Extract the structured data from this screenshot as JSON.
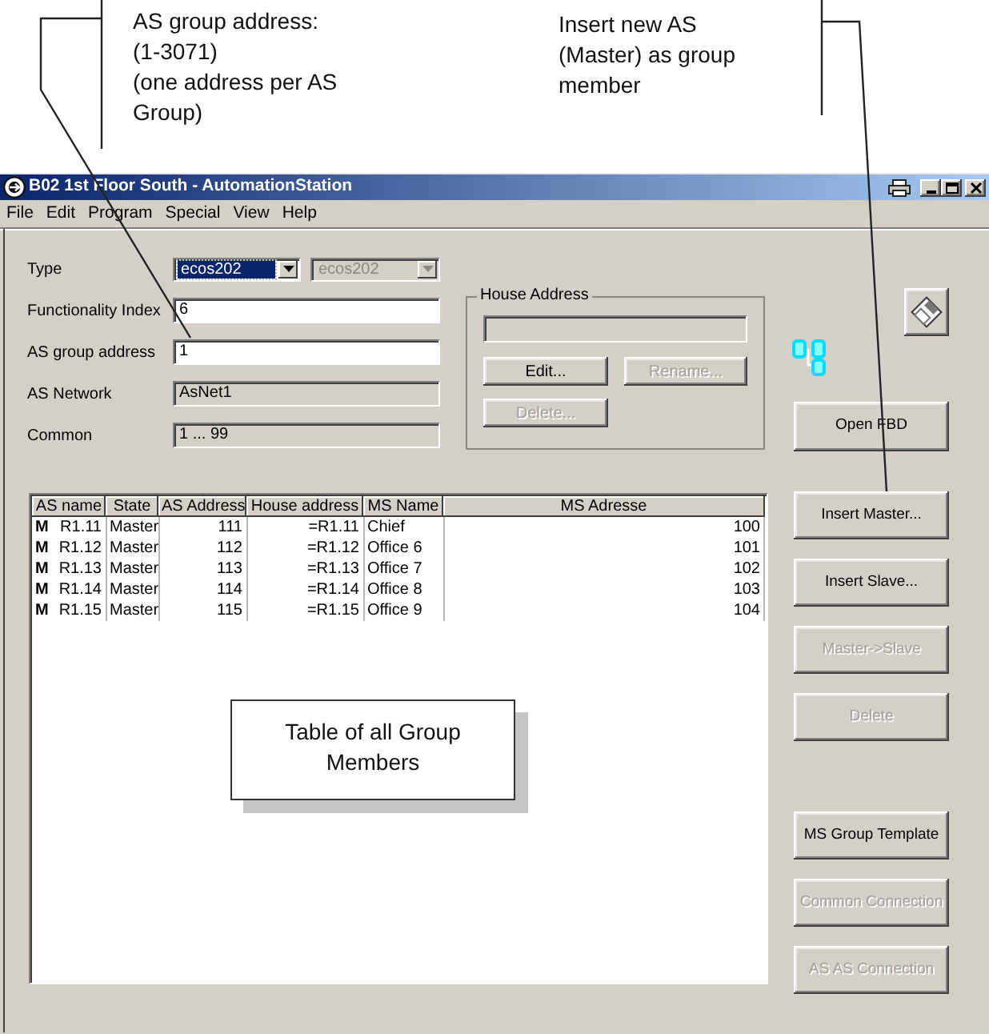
{
  "annotations": [
    {
      "lines": [
        "AS group address:",
        "(1-3071)",
        "(one address per AS",
        "Group)"
      ]
    },
    {
      "lines": [
        "Insert new AS",
        "(Master) as group",
        "member"
      ]
    }
  ],
  "window": {
    "title": "B02 1st Floor South - AutomationStation"
  },
  "menu": [
    "File",
    "Edit",
    "Program",
    "Special",
    "View",
    "Help"
  ],
  "form": {
    "fields": [
      {
        "label": "Type",
        "kind": "combo",
        "combos": [
          {
            "value": "ecos202",
            "focused": true,
            "disabled": false
          },
          {
            "value": "ecos202",
            "focused": false,
            "disabled": true
          }
        ]
      },
      {
        "label": "Functionality Index",
        "kind": "text",
        "value": "6",
        "disabled": false
      },
      {
        "label": "AS group address",
        "kind": "text",
        "value": "1",
        "disabled": false
      },
      {
        "label": "AS Network",
        "kind": "text",
        "value": "AsNet1",
        "disabled": true
      },
      {
        "label": "Common",
        "kind": "text",
        "value": "1 ... 99",
        "disabled": true
      }
    ]
  },
  "house_address": {
    "title": "House Address",
    "field": {
      "disabled": true
    },
    "buttons": [
      {
        "label": "Edit...",
        "disabled": false
      },
      {
        "label": "Rename...",
        "disabled": true
      },
      {
        "label": "Delete...",
        "disabled": true
      }
    ]
  },
  "open_fbd": {
    "label": "Open FBD",
    "disabled": false
  },
  "member_buttons": [
    {
      "label": "Insert Master...",
      "disabled": false
    },
    {
      "label": "Insert Slave...",
      "disabled": false
    },
    {
      "label": "Master->Slave",
      "disabled": true
    },
    {
      "label": "Delete",
      "disabled": true
    }
  ],
  "connection_buttons": [
    {
      "label": "MS Group Template",
      "disabled": false
    },
    {
      "label": "Common Connection",
      "disabled": true
    },
    {
      "label": "AS AS Connection",
      "disabled": true
    }
  ],
  "table": {
    "columns": [
      "AS name",
      "State",
      "AS Address",
      "House address",
      "MS Name",
      "MS Adresse"
    ],
    "rows": [
      {
        "marker": "M",
        "cells": [
          "R1.11",
          "Master",
          "111",
          "=R1.11",
          "Chief",
          "100"
        ]
      },
      {
        "marker": "M",
        "cells": [
          "R1.12",
          "Master",
          "112",
          "=R1.12",
          "Office 6",
          "101"
        ]
      },
      {
        "marker": "M",
        "cells": [
          "R1.13",
          "Master",
          "113",
          "=R1.13",
          "Office 7",
          "102"
        ]
      },
      {
        "marker": "M",
        "cells": [
          "R1.14",
          "Master",
          "114",
          "=R1.14",
          "Office 8",
          "103"
        ]
      },
      {
        "marker": "M",
        "cells": [
          "R1.15",
          "Master",
          "115",
          "=R1.15",
          "Office 9",
          "104"
        ]
      }
    ]
  },
  "callout": {
    "lines": [
      "Table of all Group",
      "Members"
    ]
  }
}
